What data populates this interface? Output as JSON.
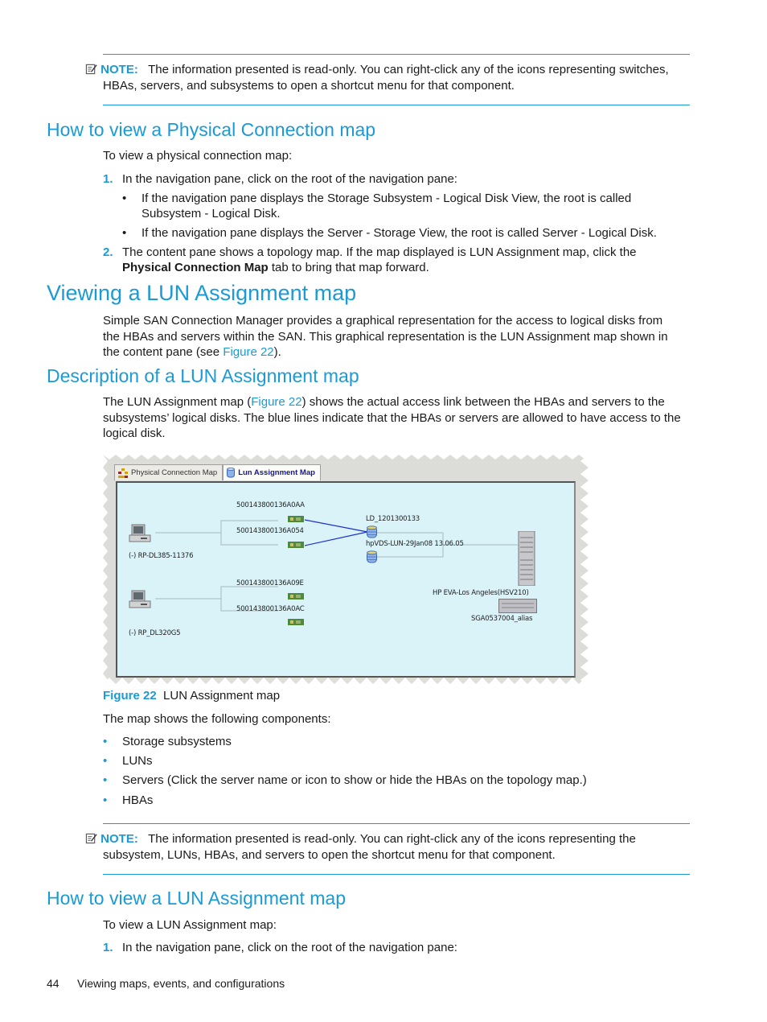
{
  "note1": {
    "label": "NOTE:",
    "text_line1": "The information presented is read-only. You can right-click any of the icons representing switches,",
    "text_line2": "HBAs, servers, and subsystems to open a shortcut menu for that component."
  },
  "section_physical": {
    "heading": "How to view a Physical Connection map",
    "intro": "To view a physical connection map:",
    "steps": [
      {
        "num": "1.",
        "text": "In the navigation pane, click on the root of the navigation pane:",
        "bullets": [
          {
            "line1": "If the navigation pane displays the Storage Subsystem - Logical Disk View, the root is called",
            "line2": "Subsystem - Logical Disk."
          },
          {
            "line1": "If the navigation pane displays the Server - Storage View, the root is called Server - Logical Disk."
          }
        ]
      },
      {
        "num": "2.",
        "text_line1": "The content pane shows a topology map. If the map displayed is LUN Assignment map, click the",
        "bold": "Physical Connection Map",
        "text_line2_rest": " tab to bring that map forward."
      }
    ]
  },
  "section_viewing": {
    "heading": "Viewing a LUN Assignment map",
    "para_line1": "Simple SAN Connection Manager provides a graphical representation for the access to logical disks from",
    "para_line2": "the HBAs and servers within the SAN. This graphical representation is the LUN Assignment map shown in",
    "para_line3_pre": "the content pane (see ",
    "para_line3_link": "Figure 22",
    "para_line3_post": ")."
  },
  "section_description": {
    "heading": "Description of a LUN Assignment map",
    "line1_pre": "The LUN Assignment map (",
    "line1_link": "Figure 22",
    "line1_post": ") shows the actual access link between the HBAs and servers to the",
    "line2": "subsystems’ logical disks. The blue lines indicate that the HBAs or servers are allowed to have access to the",
    "line3": "logical disk."
  },
  "figure": {
    "tabs": [
      {
        "label": "Physical Connection Map",
        "active": false
      },
      {
        "label": "Lun Assignment Map",
        "active": true
      }
    ],
    "servers": [
      {
        "label": "(-) RP-DL385-11376"
      },
      {
        "label": "(-) RP_DL320G5"
      }
    ],
    "hbas": [
      {
        "label": "500143800136A0AA"
      },
      {
        "label": "500143800136A054"
      },
      {
        "label": "500143800136A09E"
      },
      {
        "label": "500143800136A0AC"
      }
    ],
    "luns": [
      {
        "label": "LD_1201300133"
      },
      {
        "label": "hpVDS-LUN-29Jan08 13.06.05"
      }
    ],
    "subsystem": {
      "label": "HP EVA-Los Angeles(HSV210)",
      "alias": "SGA0537004_alias"
    },
    "link_color": "#1c2fd0",
    "caption_label": "Figure 22",
    "caption_text": "LUN Assignment map"
  },
  "components": {
    "intro": "The map shows the following components:",
    "items": [
      "Storage subsystems",
      "LUNs",
      "Servers (Click the server name or icon to show or hide the HBAs on the topology map.)",
      "HBAs"
    ]
  },
  "note2": {
    "label": "NOTE:",
    "text_line1": "The information presented is read-only. You can right-click any of the icons representing the",
    "text_line2": "subsystem, LUNs, HBAs, and servers to open the shortcut menu for that component."
  },
  "section_howlun": {
    "heading": "How to view a LUN Assignment map",
    "intro": "To view a LUN Assignment map:",
    "step1_num": "1.",
    "step1_text": "In the navigation pane, click on the root of the navigation pane:"
  },
  "footer": {
    "page_number": "44",
    "chapter": "Viewing maps, events, and configurations"
  },
  "colors": {
    "accent": "#1a9ad6",
    "text": "#1a1a1a",
    "map_background": "#d9f3f9"
  }
}
